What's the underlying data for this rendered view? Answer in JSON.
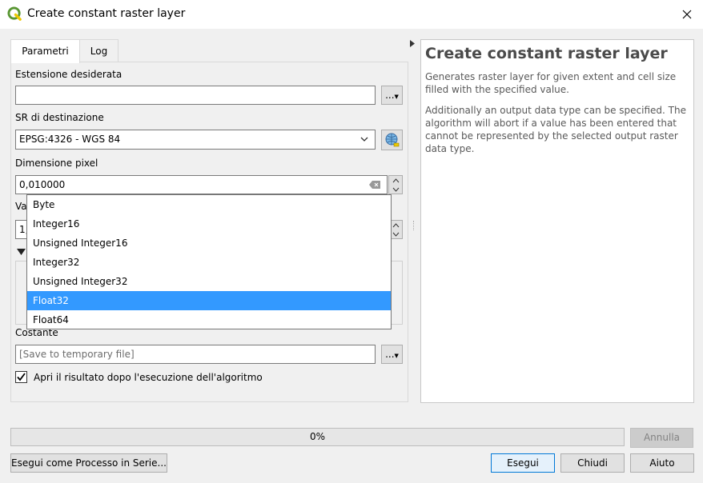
{
  "window": {
    "title": "Create constant raster layer"
  },
  "tabs": [
    {
      "label": "Parametri"
    },
    {
      "label": "Log"
    }
  ],
  "params": {
    "extent_label": "Estensione desiderata",
    "extent_value": "",
    "crs_label": "SR di destinazione",
    "crs_value": "EPSG:4326 - WGS 84",
    "pixel_label": "Dimensione pixel",
    "pixel_value": "0,010000",
    "value_label_partial": "Va",
    "value_partial": "1,",
    "output_label": "Costante",
    "output_placeholder": "[Save to temporary file]",
    "open_after_label": "Apri il risultato dopo l'esecuzione dell'algoritmo",
    "open_after_checked": true,
    "browse_label": "..."
  },
  "data_type_dropdown": {
    "options": [
      "Byte",
      "Integer16",
      "Unsigned Integer16",
      "Integer32",
      "Unsigned Integer32",
      "Float32",
      "Float64"
    ],
    "selected": "Float32"
  },
  "help": {
    "title": "Create constant raster layer",
    "p1": "Generates raster layer for given extent and cell size filled with the specified value.",
    "p2": "Additionally an output data type can be specified. The algorithm will abort if a value has been entered that cannot be represented by the selected output raster data type."
  },
  "progress": {
    "text": "0%",
    "value": 0
  },
  "buttons": {
    "cancel": "Annulla",
    "batch": "Esegui come Processo in Serie...",
    "run": "Esegui",
    "close": "Chiudi",
    "help": "Aiuto"
  },
  "colors": {
    "selection": "#3399ff",
    "qgis_green": "#589632",
    "qgis_yellow": "#eec900"
  }
}
